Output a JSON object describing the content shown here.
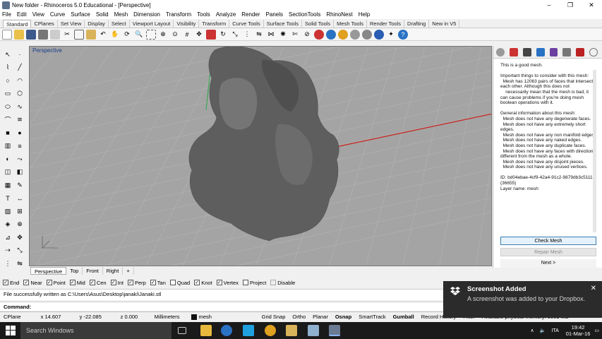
{
  "window": {
    "title": "New folder - Rhinoceros 5.0 Educational - [Perspective]",
    "controls": [
      "–",
      "❐",
      "✕"
    ]
  },
  "menu": [
    "File",
    "Edit",
    "View",
    "Curve",
    "Surface",
    "Solid",
    "Mesh",
    "Dimension",
    "Transform",
    "Tools",
    "Analyze",
    "Render",
    "Panels",
    "SectionTools",
    "RhinoNest",
    "Help"
  ],
  "toolbar_tabs": [
    "Standard",
    "CPlanes",
    "Set View",
    "Display",
    "Select",
    "Viewport Layout",
    "Visibility",
    "Transform",
    "Curve Tools",
    "Surface Tools",
    "Solid Tools",
    "Mesh Tools",
    "Render Tools",
    "Drafting",
    "New in V5"
  ],
  "toolbar_icons": [
    "new-file",
    "open-file",
    "save",
    "print",
    "import",
    "cut",
    "copy",
    "paste",
    "undo",
    "pan",
    "rotate",
    "zoom",
    "zoom-window",
    "zoom-extents",
    "zoom-selected",
    "grid",
    "move",
    "copy-objects",
    "rotate-objects",
    "scale",
    "array",
    "mirror",
    "join",
    "explode",
    "trim",
    "split",
    "layer",
    "properties",
    "render",
    "sphere",
    "shade",
    "material",
    "light",
    "help"
  ],
  "viewport": {
    "label": "Perspective",
    "tabs": [
      "Perspective",
      "Top",
      "Front",
      "Right",
      "+"
    ]
  },
  "right_panel": {
    "text": "This is a good mesh.\n\nImportant things to consider with this mesh:\n  Mesh has 12063 pairs of faces that intersect each other. Although this does not\n    necessarily mean that the mesh is bad, it can cause problems if you're doing mesh boolean operations with it.\n\nGeneral information about this mesh:\n  Mesh does not have any degenerate faces.\n  Mesh does not have any extremely short edges.\n  Mesh does not have any non manifold edges.\n  Mesh does not have any naked edges.\n  Mesh does not have any duplicate faces.\n  Mesh does not have any faces with directions different from the mesh as a whole.\n  Mesh does not have any disjoint pieces.\n  Mesh does not have any unused vertices.\n\nID: bd04ebae-4cf9-42a4-91c2-9879db3c5111 (36655)\nLayer name: mesh",
    "buttons": {
      "check": "Check Mesh",
      "repair": "Repair Mesh",
      "next": "Next >"
    }
  },
  "osnap": [
    {
      "label": "End",
      "checked": true,
      "disabled": false
    },
    {
      "label": "Near",
      "checked": true,
      "disabled": false
    },
    {
      "label": "Point",
      "checked": true,
      "disabled": false
    },
    {
      "label": "Mid",
      "checked": true,
      "disabled": false
    },
    {
      "label": "Cen",
      "checked": true,
      "disabled": false
    },
    {
      "label": "Int",
      "checked": true,
      "disabled": false
    },
    {
      "label": "Perp",
      "checked": true,
      "disabled": false
    },
    {
      "label": "Tan",
      "checked": true,
      "disabled": false
    },
    {
      "label": "Quad",
      "checked": false,
      "disabled": false
    },
    {
      "label": "Knot",
      "checked": true,
      "disabled": false
    },
    {
      "label": "Vertex",
      "checked": true,
      "disabled": false
    },
    {
      "label": "Project",
      "checked": false,
      "disabled": false
    },
    {
      "label": "Disable",
      "checked": false,
      "disabled": true
    }
  ],
  "command": {
    "history": "File successfully written as C:\\Users\\Asus\\Desktop\\janaki\\Janaki.stl",
    "prompt": "Command:"
  },
  "status": {
    "cplane": "CPlane",
    "x": "x 14.607",
    "y": "y -22.085",
    "z": "z 0.000",
    "units": "Millimeters",
    "layer": "mesh",
    "grid_snap": "Grid Snap",
    "ortho": "Ortho",
    "planar": "Planar",
    "osnap": "Osnap",
    "smarttrack": "SmartTrack",
    "gumball": "Gumball",
    "record_history": "Record History",
    "filter": "Filter",
    "memory": "Available physical memory: 8061 MB"
  },
  "taskbar": {
    "search": "Search Windows",
    "time": "19:42",
    "date": "01-Mar-16",
    "lang": "ITA"
  },
  "notification": {
    "title": "Screenshot Added",
    "message": "A screenshot was added to your Dropbox."
  },
  "colors": {
    "viewport_bg": "#a4a4a4",
    "x_axis": "#c8201a",
    "y_axis": "#2fa84a",
    "taskbar": "#1a1a1a",
    "toast": "#2b2b2b",
    "accent": "#3c7fb1"
  }
}
